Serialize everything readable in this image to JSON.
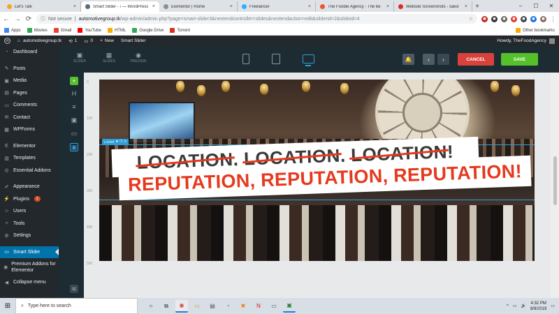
{
  "browser": {
    "tabs": [
      {
        "title": "Let's Talk",
        "favicon_color": "#f5a623"
      },
      {
        "title": "Smart Slider - ‹ — WordPress",
        "favicon_color": "#5a6b7a",
        "active": true
      },
      {
        "title": "Elementor | Home",
        "favicon_color": "#8a8f94"
      },
      {
        "title": "Freelancer",
        "favicon_color": "#29b2fe"
      },
      {
        "title": "The Foodie Agency - The be",
        "favicon_color": "#e8552b"
      },
      {
        "title": "Website Screenshots - saksl",
        "favicon_color": "#d93025"
      }
    ],
    "new_tab": "+",
    "window_controls": [
      "–",
      "☐",
      "✕"
    ],
    "security_text": "Not secure",
    "url_host": "automotivegroup.tk",
    "url_path": "/wp-admin/admin.php?page=smart-slider3&nextendcontroller=slides&nextendaction=edit&sliderid=2&slideid=4",
    "bookmarks": [
      {
        "label": "Apps",
        "color": "#4285f4"
      },
      {
        "label": "Movies",
        "color": "#34a853"
      },
      {
        "label": "Gmail",
        "color": "#ea4335"
      },
      {
        "label": "YouTube",
        "color": "#ff0000"
      },
      {
        "label": "HTML",
        "color": "#f9ab00"
      },
      {
        "label": "Google Drive",
        "color": "#34a853"
      },
      {
        "label": "Torrent",
        "color": "#d93025"
      }
    ],
    "other_bookmarks": "Other bookmarks"
  },
  "wp_admin_bar": {
    "site": "automotivegroup.tk",
    "updates": "1",
    "comments": "0",
    "new_label": "New",
    "plugin_label": "Smart Slider",
    "howdy": "Howdy, TheFoodAgency"
  },
  "sidebar": {
    "items": [
      {
        "label": "Dashboard",
        "icon": "◔"
      },
      {
        "label": "Posts",
        "icon": "✎",
        "gap": true
      },
      {
        "label": "Media",
        "icon": "▣"
      },
      {
        "label": "Pages",
        "icon": "▤"
      },
      {
        "label": "Comments",
        "icon": "▭"
      },
      {
        "label": "Contact",
        "icon": "✉"
      },
      {
        "label": "WPForms",
        "icon": "▦"
      },
      {
        "label": "Elementor",
        "icon": "E",
        "gap": true
      },
      {
        "label": "Templates",
        "icon": "▥"
      },
      {
        "label": "Essential Addons",
        "icon": "◎"
      },
      {
        "label": "Appearance",
        "icon": "✐",
        "gap": true
      },
      {
        "label": "Plugins",
        "icon": "⚡",
        "badge": "1"
      },
      {
        "label": "Users",
        "icon": "☺"
      },
      {
        "label": "Tools",
        "icon": "✧"
      },
      {
        "label": "Settings",
        "icon": "⚙"
      },
      {
        "label": "Smart Slider",
        "icon": "▭",
        "gap": true,
        "current": true
      },
      {
        "label": "Premium Addons for Elementor",
        "icon": "◉",
        "tall": true
      },
      {
        "label": "Collapse menu",
        "icon": "◀"
      }
    ]
  },
  "slider_editor": {
    "tools": [
      {
        "label": "SLIDER",
        "icon": "▣"
      },
      {
        "label": "SLIDES",
        "icon": "▦"
      },
      {
        "label": "PREVIEW",
        "icon": "◉"
      }
    ],
    "cancel_label": "CANCEL",
    "save_label": "SAVE",
    "prev_icon": "‹",
    "next_icon": "›",
    "bell_icon": "🔔",
    "left_tools": [
      "+",
      "H",
      "≡",
      "▣",
      "▭",
      "▣"
    ],
    "ruler_ticks": [
      "0",
      "100",
      "200",
      "300",
      "400",
      "500"
    ],
    "layer_label": "LAYER",
    "headline_struck": [
      "LOCATION",
      "LOCATION",
      "LOCATION"
    ],
    "headline_struck_separators": [
      ", ",
      ", ",
      "!"
    ],
    "headline_main": "REPUTATION, REPUTATION, REPUTATION!",
    "accent_red": "#e53a1e",
    "accent_blue": "#2e9fd8",
    "save_green": "#55c02b",
    "cancel_red": "#d9423b"
  },
  "taskbar": {
    "search_placeholder": "Type here to search",
    "time": "4:32 PM",
    "date": "8/9/2019",
    "tray_icons": [
      "^",
      "▭",
      "🔊",
      "ENG"
    ]
  }
}
